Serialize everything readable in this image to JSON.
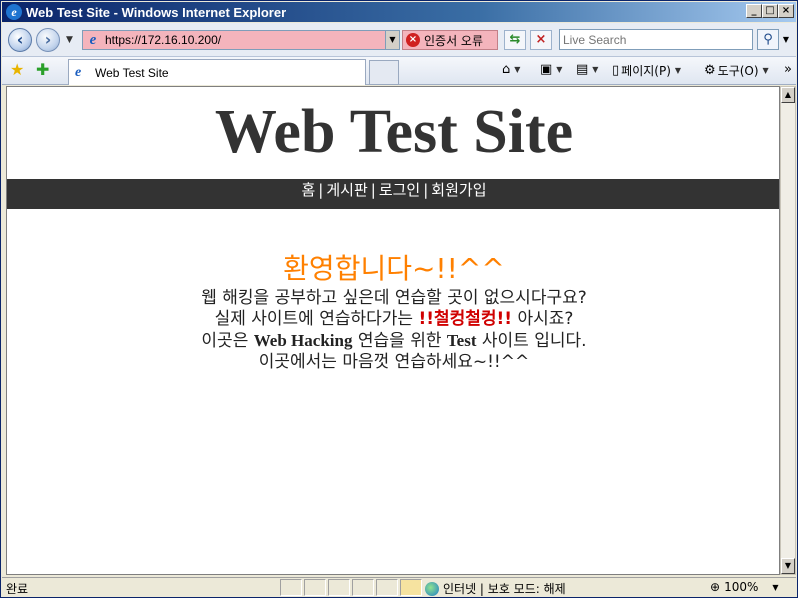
{
  "window": {
    "title": "Web Test Site - Windows Internet Explorer",
    "min": "_",
    "max": "□",
    "close": "×"
  },
  "address": {
    "url": "https://172.16.10.200/",
    "cert_error": "인증서 오류"
  },
  "search": {
    "placeholder": "Live Search"
  },
  "tab": {
    "title": "Web Test Site"
  },
  "commands": {
    "page": "페이지(P)",
    "tools": "도구(O)"
  },
  "site": {
    "title": "Web Test Site",
    "menu": [
      "홈",
      "게시판",
      "로그인",
      "회원가입"
    ],
    "welcome": "환영합니다~!!^^",
    "line1": "웹 해킹을 공부하고 싶은데 연습할 곳이 없으시다구요?",
    "line2_pre": "실제 사이트에 연습하다가는 ",
    "line2_red": "!!철컹철컹!!",
    "line2_post": " 아시죠?",
    "line3_pre": "이곳은 ",
    "line3_bold1": "Web Hacking",
    "line3_mid": " 연습을 위한 ",
    "line3_bold2": "Test",
    "line3_post": " 사이트 입니다.",
    "line4": "이곳에서는 마음껏 연습하세요~!!^^"
  },
  "status": {
    "text": "완료",
    "zone": "인터넷 | 보호 모드: 해제",
    "zoom": "100%"
  }
}
